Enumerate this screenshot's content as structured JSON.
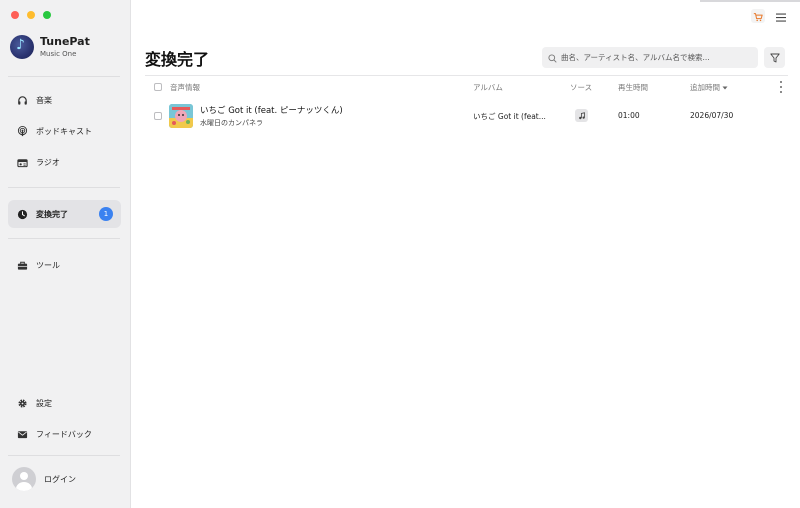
{
  "brand": {
    "name": "TunePat",
    "subtitle": "Music One"
  },
  "sidebar": {
    "items": [
      {
        "label": "音楽",
        "icon": "headphones-icon"
      },
      {
        "label": "ポッドキャスト",
        "icon": "podcast-icon"
      },
      {
        "label": "ラジオ",
        "icon": "radio-icon"
      },
      {
        "label": "変換完了",
        "icon": "clock-icon",
        "badge": "1",
        "active": true
      },
      {
        "label": "ツール",
        "icon": "toolbox-icon"
      },
      {
        "label": "設定",
        "icon": "gear-icon"
      },
      {
        "label": "フィードバック",
        "icon": "mail-icon"
      }
    ],
    "login_label": "ログイン"
  },
  "main": {
    "title": "変換完了",
    "search_placeholder": "曲名、アーティスト名、アルバム名で検索...",
    "columns": {
      "info": "音声情報",
      "album": "アルバム",
      "source": "ソース",
      "duration": "再生時間",
      "added": "追加時間"
    },
    "rows": [
      {
        "title": "いちご Got it (feat. ピーナッツくん)",
        "artist": "水曜日のカンパネラ",
        "album": "いちご Got it (feat...",
        "duration": "01:00",
        "added": "2026/07/30"
      }
    ]
  },
  "colors": {
    "accent": "#3b82f0",
    "sidebar_bg": "#f1f1f2",
    "cart": "#e8782a"
  }
}
